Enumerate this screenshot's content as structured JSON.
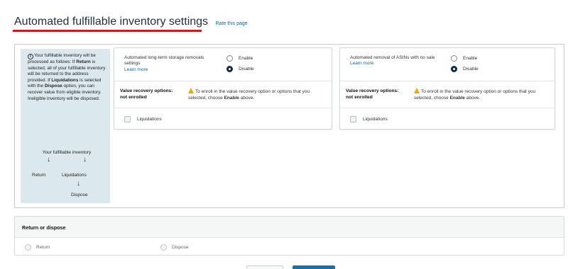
{
  "header": {
    "title": "Automated fulfillable inventory settings",
    "rate_link": "Rate this page",
    "accent_color": "#d0191e"
  },
  "info": {
    "icon": "info-icon",
    "text_1": "Your fulfillable inventory will be processed as follows: If ",
    "bold_return": "Return",
    "text_2": " is selected, all of your fulfillable inventory will be returned to the address provided. If ",
    "bold_liquidations": "Liquidations",
    "text_3": " is selected with the ",
    "bold_dispose": "Dispose",
    "text_4": " option, you can recover value from eligible inventory. Ineligible inventory will be disposed.",
    "flow": {
      "root": "Your fulfillable inventory",
      "return": "Return",
      "liquidations": "Liquidations",
      "dispose": "Dispose",
      "arrow_glyph": "↓"
    }
  },
  "cards": [
    {
      "label": "Automated long-term storage removals settings",
      "learn_more": "Learn more",
      "options": [
        {
          "label": "Enable",
          "checked": false
        },
        {
          "label": "Disable",
          "checked": true
        }
      ],
      "recovery_status": "Value recovery options: not enrolled",
      "warning_icon": "warning-icon",
      "recovery_msg_1": "To enroll in the value recovery option or options that you selected, choose ",
      "recovery_msg_bold": "Enable",
      "recovery_msg_2": " above.",
      "checkbox_label": "Liquidations",
      "checkbox_checked": false
    },
    {
      "label": "Automated removal of ASINs with no sale",
      "learn_more": "Learn more",
      "options": [
        {
          "label": "Enable",
          "checked": false
        },
        {
          "label": "Disable",
          "checked": true
        }
      ],
      "recovery_status": "Value recovery options: not enrolled",
      "warning_icon": "warning-icon",
      "recovery_msg_1": "To enroll in the value recovery option or options that you selected, choose ",
      "recovery_msg_bold": "Enable",
      "recovery_msg_2": " above.",
      "checkbox_label": "Liquidations",
      "checkbox_checked": false
    }
  ],
  "return_or_dispose": {
    "title": "Return or dispose",
    "options": [
      {
        "label": "Return",
        "checked": false
      },
      {
        "label": "Dispose",
        "checked": false
      }
    ]
  }
}
